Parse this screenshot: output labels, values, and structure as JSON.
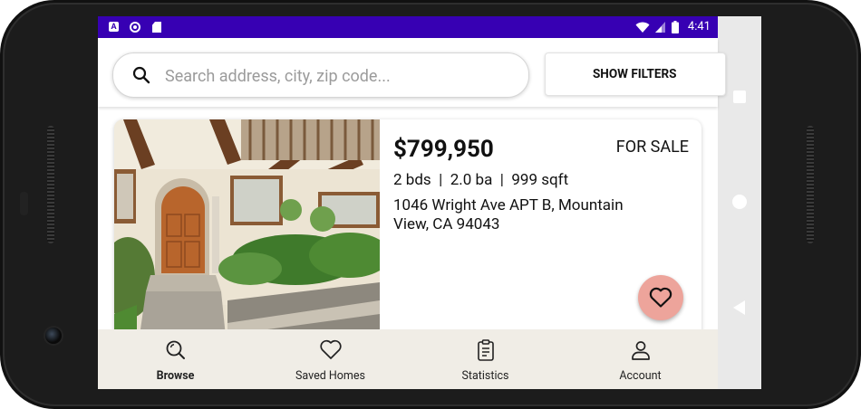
{
  "status_bar": {
    "time": "4:41",
    "icons": [
      "a-notification-icon",
      "circle-notification-icon",
      "sd-card-icon",
      "wifi-icon",
      "cell-signal-icon",
      "battery-icon"
    ]
  },
  "search": {
    "placeholder": "Search address, city, zip code...",
    "value": ""
  },
  "filters_button": {
    "label": "SHOW FILTERS"
  },
  "listing": {
    "price": "$799,950",
    "status": "FOR SALE",
    "beds": "2 bds",
    "baths": "2.0 ba",
    "sqft": "999 sqft",
    "specs_separator": "|",
    "address": "1046 Wright Ave APT B, Mountain View, CA 94043",
    "favorite_icon": "heart-outline-icon"
  },
  "bottom_nav": {
    "items": [
      {
        "label": "Browse",
        "icon": "search-icon",
        "active": true
      },
      {
        "label": "Saved Homes",
        "icon": "heart-outline-icon",
        "active": false
      },
      {
        "label": "Statistics",
        "icon": "clipboard-icon",
        "active": false
      },
      {
        "label": "Account",
        "icon": "person-icon",
        "active": false
      }
    ]
  },
  "colors": {
    "status_bar": "#3700b3",
    "favorite_button": "#eda49b",
    "bottom_nav_bg": "#f0ede6",
    "system_nav_bg": "#e9e9e9"
  }
}
